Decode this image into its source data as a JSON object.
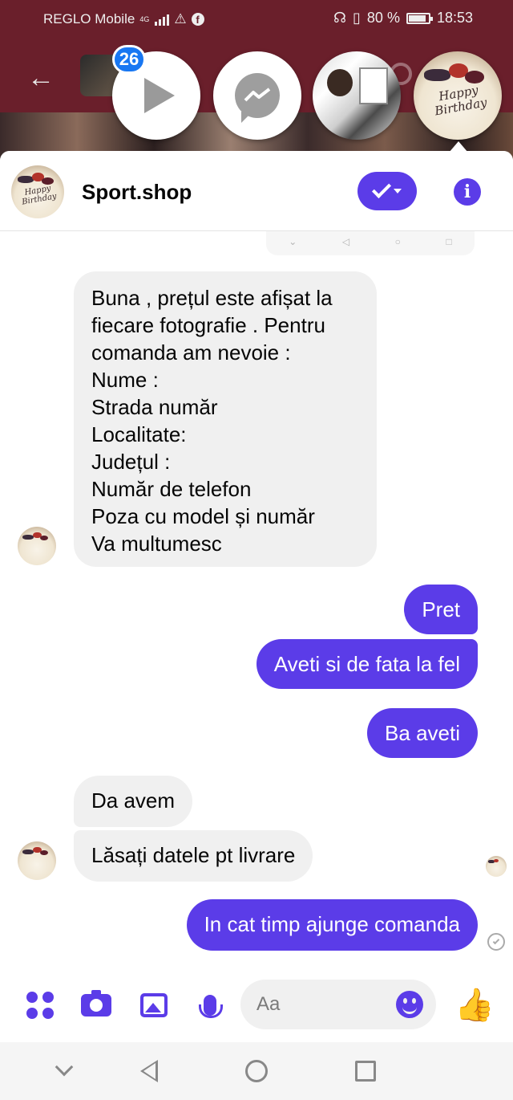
{
  "status_bar": {
    "carrier": "REGLO Mobile",
    "network": "4G",
    "battery_percent": "80 %",
    "time": "18:53"
  },
  "chat_heads": {
    "unread_count": "26",
    "items": [
      "video-player",
      "messenger",
      "contact-photo",
      "sport-shop"
    ]
  },
  "conversation": {
    "name": "Sport.shop",
    "accent_color": "#5b3ce8"
  },
  "messages": [
    {
      "from": "them",
      "text": "Buna , prețul este afișat la fiecare fotografie .   Pentru comanda am nevoie :\nNume :\nStrada număr\nLocalitate:\nJudețul :\nNumăr de telefon\nPoza cu model și număr\nVa multumesc"
    },
    {
      "from": "me",
      "text": "Pret"
    },
    {
      "from": "me",
      "text": "Aveti si de fata la fel"
    },
    {
      "from": "me",
      "text": "Ba aveti"
    },
    {
      "from": "them",
      "text": "Da avem"
    },
    {
      "from": "them",
      "text": "Lăsați datele pt livrare"
    },
    {
      "from": "me",
      "text": "In cat timp ajunge comanda"
    }
  ],
  "composer": {
    "placeholder": "Aa",
    "icons": [
      "apps-icon",
      "camera-icon",
      "gallery-icon",
      "microphone-icon",
      "emoji-icon",
      "like-icon"
    ]
  },
  "avatar_caption": "Happy Birthday"
}
